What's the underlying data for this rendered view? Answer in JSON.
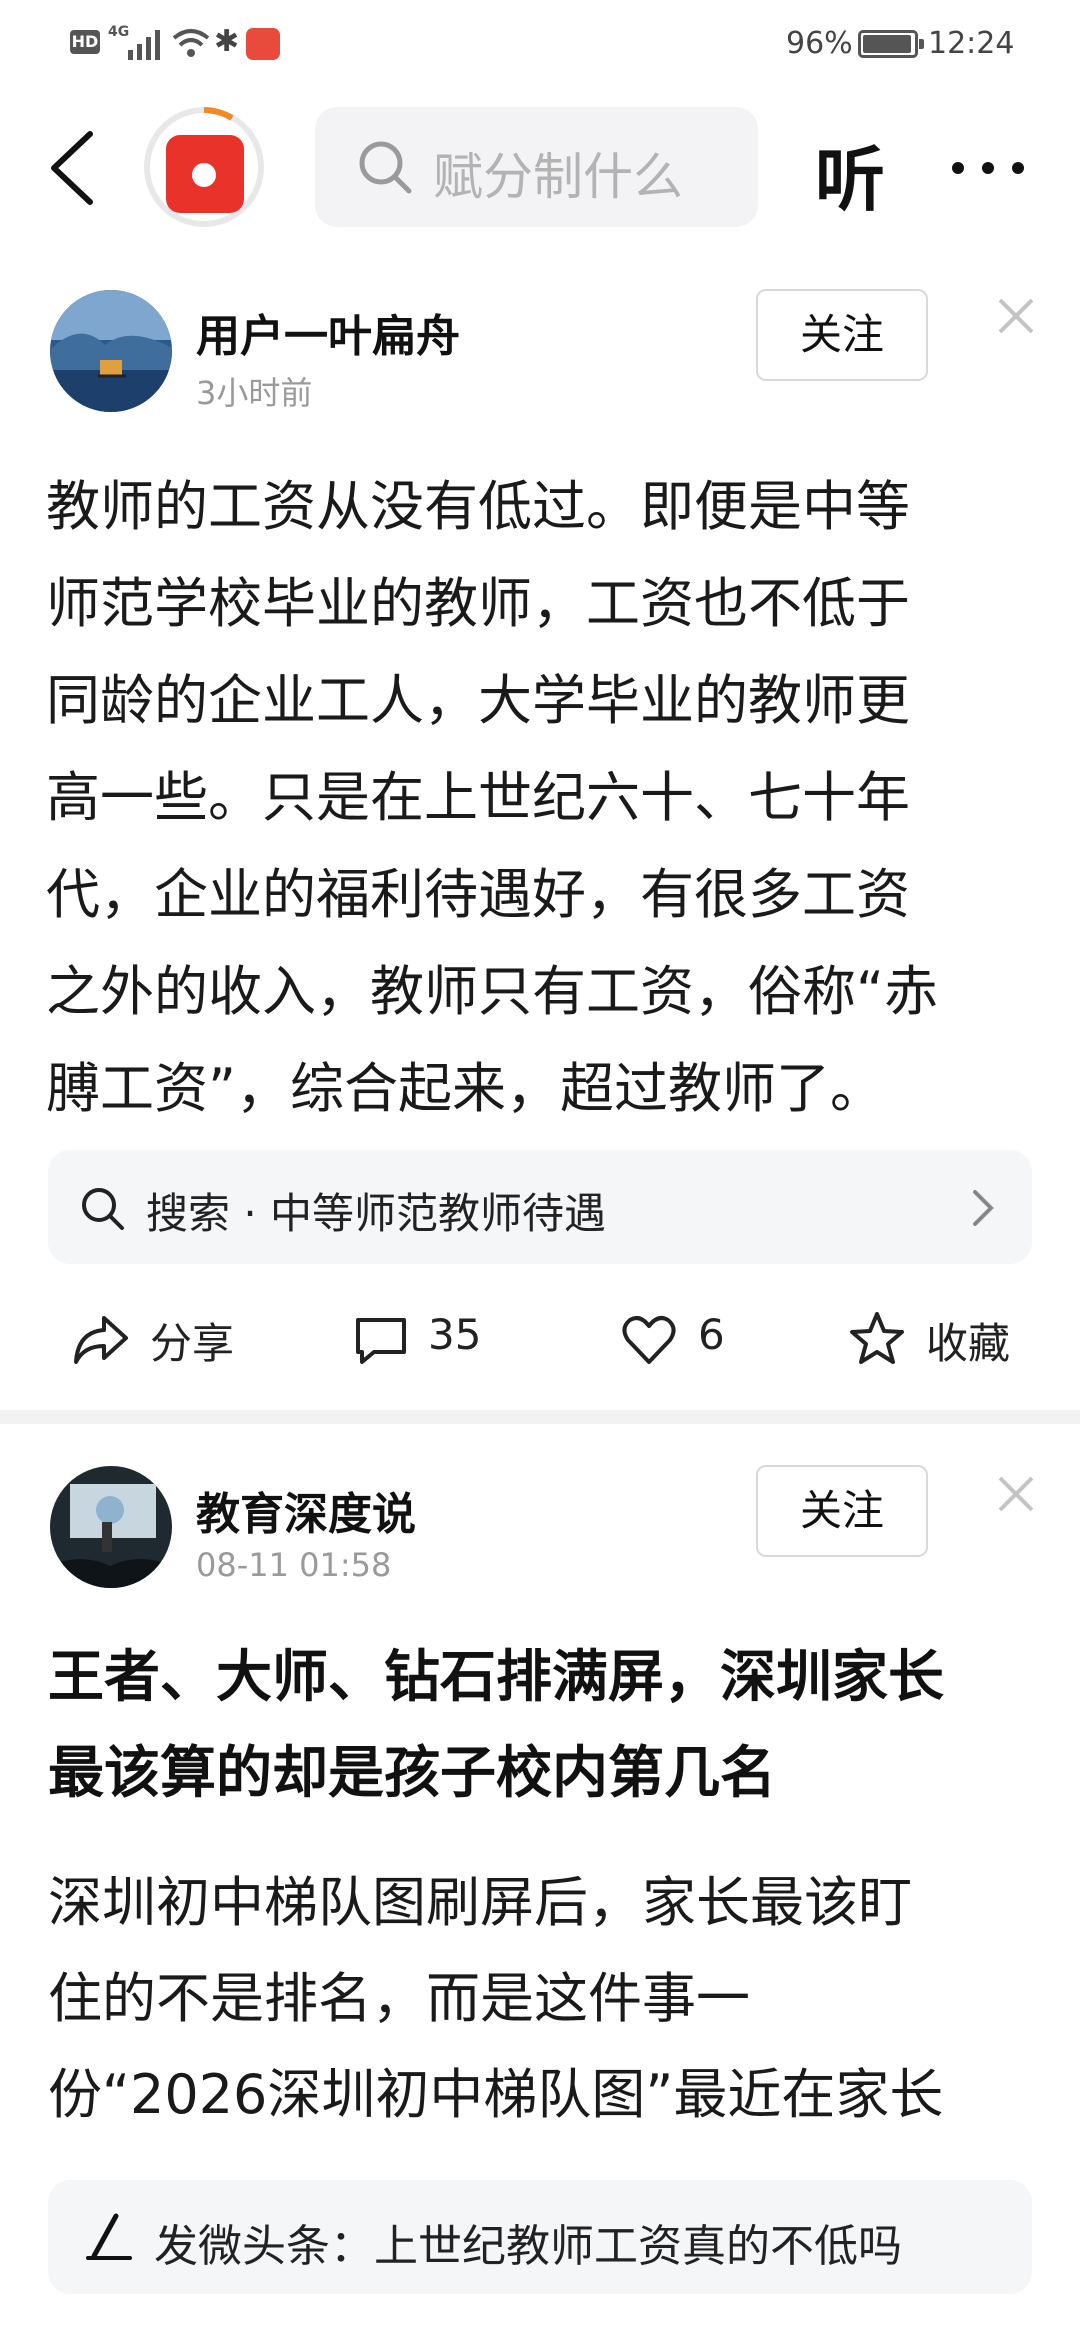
{
  "status_bar": {
    "battery": "96%",
    "time": "12:24",
    "network": "4G",
    "hd": "HD"
  },
  "topbar": {
    "search_placeholder": "赋分制什么",
    "listen_label": "听"
  },
  "post1": {
    "author": "用户一叶扁舟",
    "time": "3小时前",
    "follow_label": "关注",
    "lines": [
      "教师的工资从没有低过。即便是中等",
      "师范学校毕业的教师，工资也不低于",
      "同龄的企业工人，大学毕业的教师更",
      "高一些。只是在上世纪六十、七十年",
      "代，企业的福利待遇好，有很多工资",
      "之外的收入，教师只有工资，俗称“赤",
      "膊工资”，综合起来，超过教师了。"
    ],
    "search_suggestion": "搜索 · 中等师范教师待遇",
    "actions": {
      "share": "分享",
      "comments": "35",
      "likes": "6",
      "favorite": "收藏"
    }
  },
  "post2": {
    "author": "教育深度说",
    "time": "08-11 01:58",
    "follow_label": "关注",
    "title_lines": [
      "王者、大师、钻石排满屏，深圳家长",
      "最该算的却是孩子校内第几名"
    ],
    "lines": [
      "深圳初中梯队图刷屏后，家长最该盯",
      "住的不是排名，而是这件事一",
      "份“2026深圳初中梯队图”最近在家长"
    ]
  },
  "bottom_bar": {
    "label": "发微头条：上世纪教师工资真的不低吗"
  }
}
